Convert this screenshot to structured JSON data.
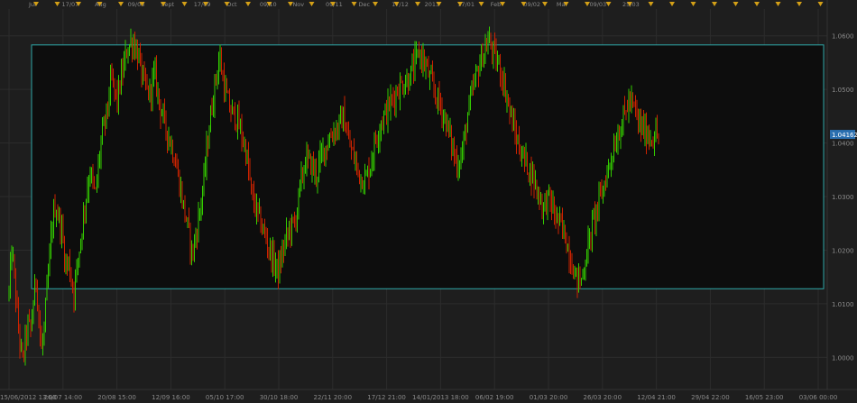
{
  "colors": {
    "background": "#1e1e1e",
    "grid": "#2c2c2c",
    "up_candle": "#33cc00",
    "down_candle": "#cc2200",
    "rectangle_stroke": "#2ea7a7",
    "rectangle_fill": "#0d0d0d",
    "marker": "#d4a017",
    "axis_text": "#8a8a8a",
    "price_tag_fill": "#2a6fb0",
    "price_tag_text": "#ffffff"
  },
  "chart_data": {
    "type": "line",
    "instrument_kind": "candlestick",
    "grid": true,
    "ylim": [
      0.994,
      1.065
    ],
    "y_ticks": [
      {
        "value": 1.0,
        "label": "1.0000"
      },
      {
        "value": 1.01,
        "label": "1.0100"
      },
      {
        "value": 1.02,
        "label": "1.0200"
      },
      {
        "value": 1.03,
        "label": "1.0300"
      },
      {
        "value": 1.04,
        "label": "1.0400"
      },
      {
        "value": 1.05,
        "label": "1.0500"
      },
      {
        "value": 1.06,
        "label": "1.0600"
      }
    ],
    "last_price": {
      "value": 1.0416,
      "label": "1.04162"
    },
    "x_ticks": [
      "15/06/2012 13:00",
      "26/07 14:00",
      "20/08 15:00",
      "12/09 16:00",
      "05/10 17:00",
      "30/10 18:00",
      "22/11 20:00",
      "17/12 21:00",
      "14/01/2013 18:00",
      "06/02 19:00",
      "01/03 20:00",
      "26/03 20:00",
      "12/04 21:00",
      "29/04 22:00",
      "16/05 23:00",
      "03/06 00:00"
    ],
    "top_labels": [
      "Jul",
      "17/07",
      "Aug",
      "09/08",
      "Sept",
      "17/09",
      "Oct",
      "09/10",
      "Nov",
      "09/11",
      "Dec",
      "17/12",
      "2013",
      "17/01",
      "Feb",
      "09/02",
      "Mar",
      "09/03",
      "25/03"
    ],
    "rectangle": {
      "y_top": 1.0583,
      "y_bottom": 1.0128,
      "x_start": "23/07 12:00",
      "x_end": "03/06 00:00"
    },
    "series": [
      {
        "x_ticks_index": [
          0,
          0.05,
          0.1,
          0.15,
          0.2,
          0.25,
          0.3,
          0.35,
          0.4,
          0.45,
          0.5,
          0.55,
          0.6,
          0.65,
          0.7,
          0.75,
          0.8,
          0.85,
          0.9,
          0.95,
          1.0,
          1.05,
          1.1,
          1.15,
          1.2,
          1.3,
          1.4,
          1.5,
          1.6,
          1.7,
          1.8,
          1.9,
          2.0,
          2.1,
          2.2,
          2.3,
          2.4,
          2.5,
          2.6,
          2.7,
          2.8,
          2.9,
          3.0,
          3.1,
          3.2,
          3.3,
          3.4,
          3.5,
          3.6,
          3.7,
          3.8,
          3.9,
          4.0,
          4.1,
          4.2,
          4.3,
          4.4,
          4.5,
          4.6,
          4.7,
          4.8,
          4.9,
          5.0,
          5.1,
          5.2,
          5.3,
          5.4,
          5.5,
          5.6,
          5.7,
          5.8,
          5.9,
          6.0,
          6.1,
          6.2,
          6.3,
          6.4,
          6.5,
          6.6,
          6.7,
          6.8,
          6.9,
          7.0,
          7.1,
          7.2,
          7.3,
          7.4,
          7.5,
          7.6,
          7.7,
          7.8,
          7.9,
          8.0,
          8.1,
          8.2,
          8.3,
          8.4,
          8.5,
          8.6,
          8.7,
          8.8,
          8.9,
          9.0,
          9.1,
          9.2,
          9.3,
          9.4,
          9.5,
          9.6,
          9.7,
          9.8,
          9.9,
          10.0,
          10.1,
          10.2,
          10.3,
          10.4,
          10.5,
          10.6,
          10.7,
          10.8,
          10.9,
          11.0,
          11.1,
          11.2,
          11.3,
          11.4,
          11.5,
          11.6,
          11.7,
          11.8,
          11.9,
          12.0,
          12.05
        ],
        "values": [
          1.012,
          1.02,
          1.015,
          1.008,
          1.003,
          0.999,
          1.003,
          1.006,
          1.005,
          1.01,
          1.015,
          1.008,
          1.001,
          1.005,
          1.012,
          1.018,
          1.025,
          1.028,
          1.027,
          1.025,
          1.022,
          1.017,
          1.018,
          1.015,
          1.012,
          1.02,
          1.028,
          1.035,
          1.03,
          1.04,
          1.045,
          1.052,
          1.048,
          1.053,
          1.058,
          1.059,
          1.056,
          1.051,
          1.049,
          1.053,
          1.047,
          1.043,
          1.04,
          1.036,
          1.03,
          1.025,
          1.019,
          1.025,
          1.032,
          1.042,
          1.05,
          1.056,
          1.05,
          1.046,
          1.045,
          1.042,
          1.038,
          1.03,
          1.027,
          1.024,
          1.021,
          1.018,
          1.016,
          1.021,
          1.024,
          1.025,
          1.032,
          1.037,
          1.036,
          1.034,
          1.038,
          1.04,
          1.042,
          1.043,
          1.045,
          1.04,
          1.037,
          1.034,
          1.033,
          1.036,
          1.041,
          1.044,
          1.046,
          1.048,
          1.05,
          1.051,
          1.052,
          1.054,
          1.057,
          1.055,
          1.052,
          1.049,
          1.047,
          1.044,
          1.04,
          1.036,
          1.038,
          1.045,
          1.05,
          1.054,
          1.057,
          1.059,
          1.056,
          1.054,
          1.05,
          1.045,
          1.041,
          1.038,
          1.036,
          1.034,
          1.031,
          1.028,
          1.03,
          1.027,
          1.025,
          1.023,
          1.019,
          1.015,
          1.014,
          1.019,
          1.024,
          1.028,
          1.031,
          1.035,
          1.039,
          1.042,
          1.045,
          1.048,
          1.046,
          1.043,
          1.042,
          1.041,
          1.0416,
          1.0416
        ]
      }
    ]
  }
}
